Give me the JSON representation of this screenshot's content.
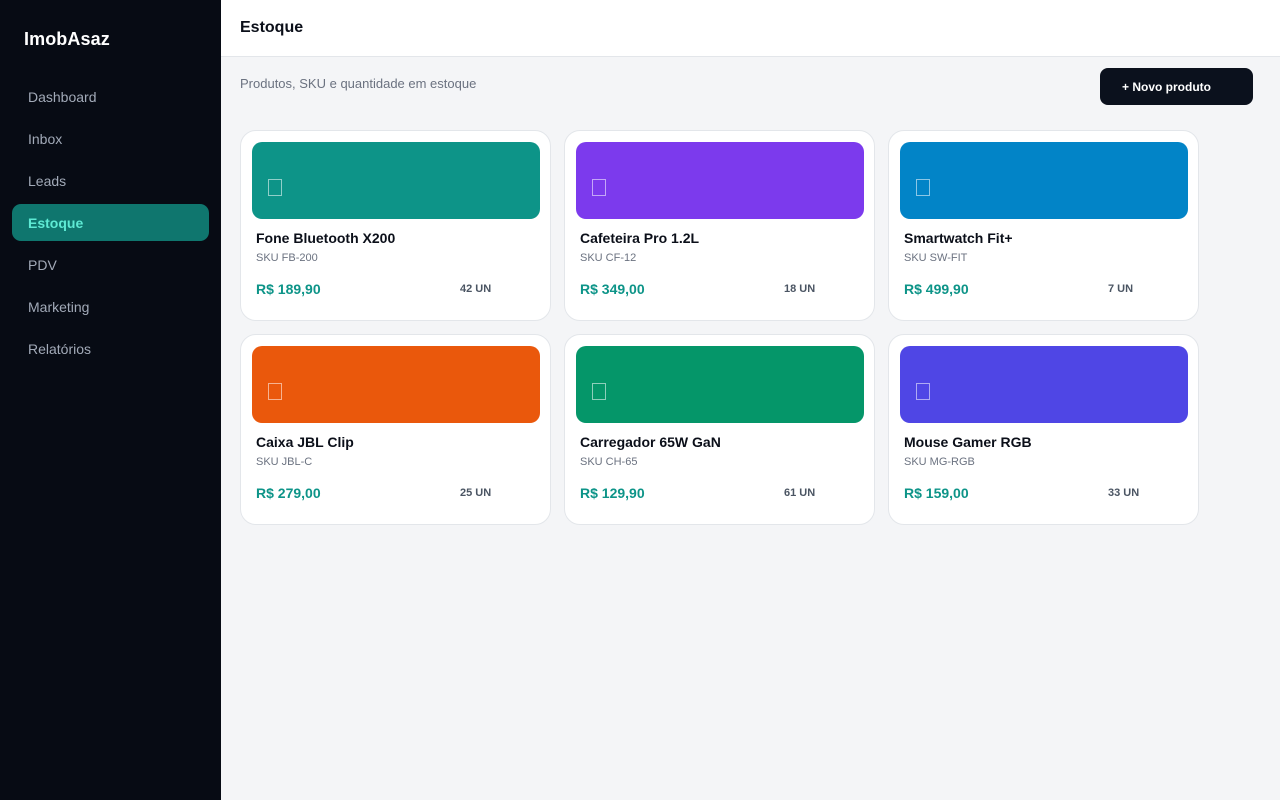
{
  "sidebar": {
    "brand": "ImobAsaz",
    "items": [
      {
        "label": "Dashboard",
        "active": false
      },
      {
        "label": "Inbox",
        "active": false
      },
      {
        "label": "Leads",
        "active": false
      },
      {
        "label": "Estoque",
        "active": true
      },
      {
        "label": "PDV",
        "active": false
      },
      {
        "label": "Marketing",
        "active": false
      },
      {
        "label": "Relatórios",
        "active": false
      }
    ]
  },
  "header": {
    "title": "Estoque"
  },
  "main": {
    "subtitle": "Produtos, SKU e quantidade em estoque",
    "new_button": "+ Novo produto",
    "products": [
      {
        "name": "Fone Bluetooth X200",
        "sku": "SKU FB-200",
        "price": "R$ 189,90",
        "qty": "42 UN",
        "color": "#0d9488",
        "icon": "image-placeholder-icon"
      },
      {
        "name": "Cafeteira Pro 1.2L",
        "sku": "SKU CF-12",
        "price": "R$ 349,00",
        "qty": "18 UN",
        "color": "#7c3aed",
        "icon": "image-placeholder-icon"
      },
      {
        "name": "Smartwatch Fit+",
        "sku": "SKU SW-FIT",
        "price": "R$ 499,90",
        "qty": "7 UN",
        "color": "#0284c7",
        "icon": "image-placeholder-icon"
      },
      {
        "name": "Caixa JBL Clip",
        "sku": "SKU JBL-C",
        "price": "R$ 279,00",
        "qty": "25 UN",
        "color": "#ea580c",
        "icon": "image-placeholder-icon"
      },
      {
        "name": "Carregador 65W GaN",
        "sku": "SKU CH-65",
        "price": "R$ 129,90",
        "qty": "61 UN",
        "color": "#059669",
        "icon": "image-placeholder-icon"
      },
      {
        "name": "Mouse Gamer RGB",
        "sku": "SKU MG-RGB",
        "price": "R$ 159,00",
        "qty": "33 UN",
        "color": "#4f46e5",
        "icon": "image-placeholder-icon"
      }
    ]
  },
  "colors": {
    "sidebar_bg": "#070b14",
    "accent": "#0d9488",
    "active_nav_bg": "#0f766e",
    "active_nav_text": "#5eead4"
  }
}
